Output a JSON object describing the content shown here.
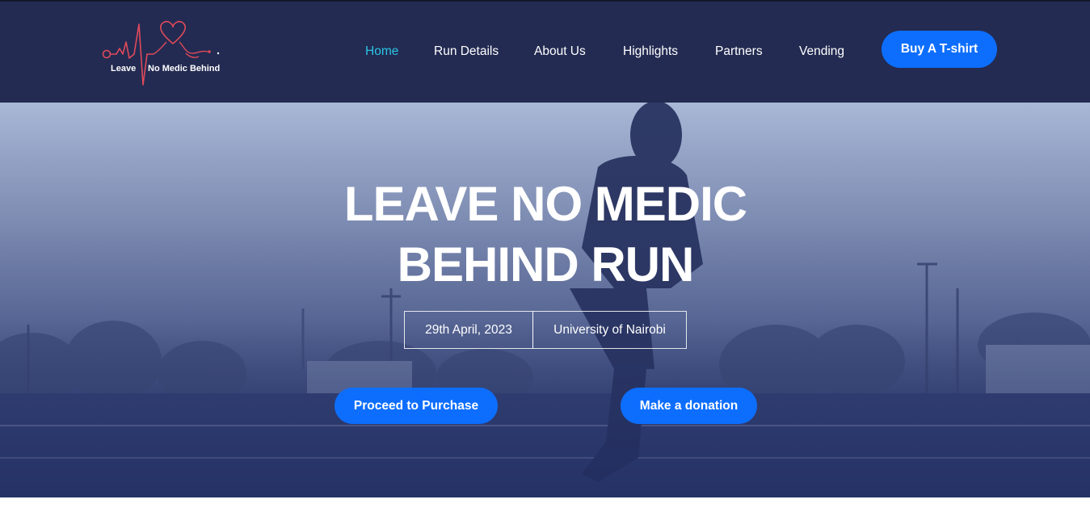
{
  "logo": {
    "word1": "Leave",
    "word2": "No Medic Behind"
  },
  "nav": {
    "items": [
      {
        "label": "Home",
        "active": true
      },
      {
        "label": "Run Details",
        "active": false
      },
      {
        "label": "About Us",
        "active": false
      },
      {
        "label": "Highlights",
        "active": false
      },
      {
        "label": "Partners",
        "active": false
      },
      {
        "label": "Vending",
        "active": false
      }
    ],
    "cta_label": "Buy A T-shirt"
  },
  "hero": {
    "title_line1": "LEAVE NO MEDIC",
    "title_line2": "BEHIND RUN",
    "date": "29th April, 2023",
    "location": "University of Nairobi",
    "purchase_label": "Proceed to Purchase",
    "donate_label": "Make a donation"
  },
  "colors": {
    "navbar": "#232b52",
    "accent_active": "#2bc4e3",
    "button": "#0d6efd",
    "logo_line": "#e0495a"
  }
}
